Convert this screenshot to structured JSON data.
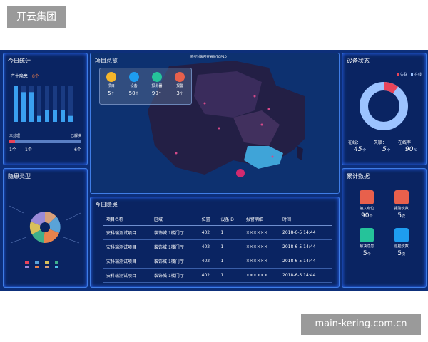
{
  "brand": {
    "top_label": "开云集团",
    "footer_label": "main-kering.com.cn"
  },
  "today_stats": {
    "title": "今日统计",
    "subtitle": "产生隐患：",
    "subtitle_value": "8个",
    "bar_values": [
      6,
      5,
      5,
      1,
      2,
      2,
      2,
      1
    ],
    "processing_label": "未处理",
    "resolved_label": "已解决",
    "count_a": "1个",
    "count_b": "1个",
    "count_c": "6个"
  },
  "hazard_type": {
    "title": "隐患类型"
  },
  "project_overview": {
    "title": "项目总览",
    "map_title": "购买对象所在省份TOP10",
    "stats": [
      {
        "label": "项目",
        "value": "5",
        "unit": "个",
        "color": "#f5b62b",
        "icon": "project-icon"
      },
      {
        "label": "设备",
        "value": "50",
        "unit": "个",
        "color": "#1e9df0",
        "icon": "device-icon"
      },
      {
        "label": "探测器",
        "value": "90",
        "unit": "个",
        "color": "#25c39a",
        "icon": "detector-icon"
      },
      {
        "label": "报警",
        "value": "3",
        "unit": "个",
        "color": "#e8604c",
        "icon": "alarm-icon"
      }
    ]
  },
  "device_status": {
    "title": "设备状态",
    "legend": [
      {
        "label": "失联",
        "color": "#e9445a"
      },
      {
        "label": "在线",
        "color": "#9cc3ff"
      }
    ],
    "online_label": "在线：",
    "online_value": "45",
    "online_unit": "个",
    "offline_label": "失联：",
    "offline_value": "5",
    "offline_unit": "个",
    "rate_label": "在线率：",
    "rate_value": "90",
    "rate_unit": "%"
  },
  "cumulative": {
    "title": "累计数据",
    "items": [
      {
        "label": "接入点位",
        "value": "90",
        "unit": "个",
        "color": "#e8604c",
        "icon": "gauge-icon"
      },
      {
        "label": "报警次数",
        "value": "5",
        "unit": "次",
        "color": "#e8604c",
        "icon": "siren-icon"
      },
      {
        "label": "解决隐患",
        "value": "5",
        "unit": "个",
        "color": "#25c39a",
        "icon": "warning-icon"
      },
      {
        "label": "巡检次数",
        "value": "5",
        "unit": "次",
        "color": "#1e9df0",
        "icon": "inspector-icon"
      }
    ]
  },
  "today_hazards": {
    "title": "今日隐患",
    "columns": [
      "项目名称",
      "区域",
      "位置",
      "设备ID",
      "报警明细",
      "时间"
    ],
    "rows": [
      [
        "安科瑞测试项目",
        "装饰城 1楼门厅",
        "402",
        "1",
        "××××××",
        "2018-6-5  14:44"
      ],
      [
        "安科瑞测试项目",
        "装饰城 1楼门厅",
        "402",
        "1",
        "××××××",
        "2018-6-5  14:44"
      ],
      [
        "安科瑞测试项目",
        "装饰城 1楼门厅",
        "402",
        "1",
        "××××××",
        "2018-6-5  14:44"
      ],
      [
        "安科瑞测试项目",
        "装饰城 1楼门厅",
        "402",
        "1",
        "××××××",
        "2018-6-5  14:44"
      ]
    ]
  }
}
